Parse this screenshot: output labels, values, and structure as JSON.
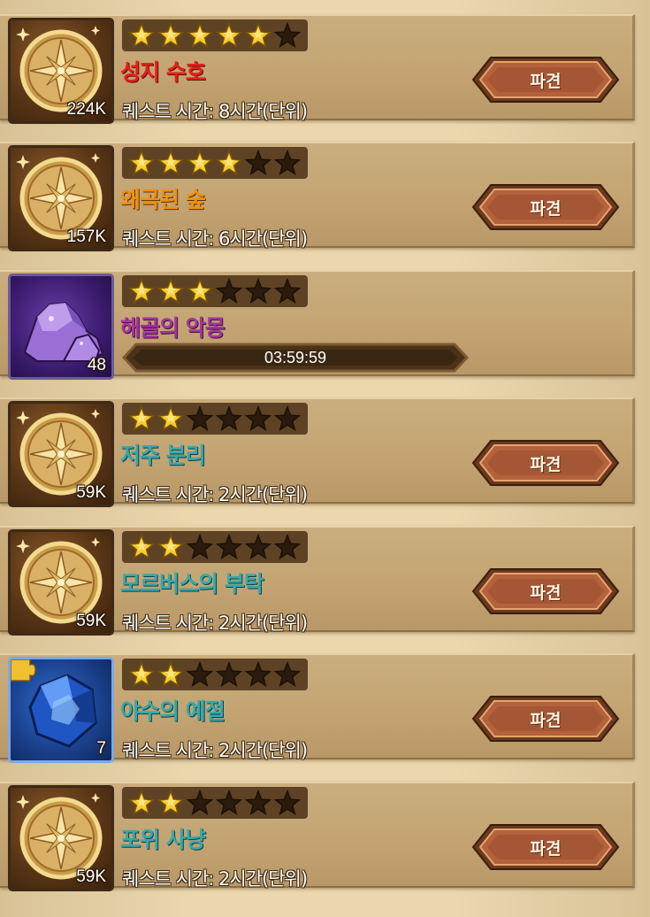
{
  "colors": {
    "star_on": "#f6cd2c",
    "star_off": "#2b1b0c",
    "name_red": "#e8201a",
    "name_orange": "#f09010",
    "name_violet": "#a4359c",
    "name_teal": "#38a8aa"
  },
  "quests": [
    {
      "icon": "compass-icon",
      "count": "224K",
      "stars": 5,
      "name": "성지 수호",
      "name_color": "red",
      "time": "퀘스트 시간: 8시간(단위)",
      "button": "파견"
    },
    {
      "icon": "compass-icon",
      "count": "157K",
      "stars": 4,
      "name": "왜곡된 숲",
      "name_color": "orange",
      "time": "퀘스트 시간: 6시간(단위)",
      "button": "파견"
    },
    {
      "icon": "purple-ore-icon",
      "count": "48",
      "stars": 3,
      "name": "해골의 악몽",
      "name_color": "violet",
      "timer": "03:59:59"
    },
    {
      "icon": "compass-icon",
      "count": "59K",
      "stars": 2,
      "name": "저주 분리",
      "name_color": "teal",
      "time": "퀘스트 시간: 2시간(단위)",
      "button": "파견"
    },
    {
      "icon": "compass-icon",
      "count": "59K",
      "stars": 2,
      "name": "모르버스의 부탁",
      "name_color": "teal",
      "time": "퀘스트 시간: 2시간(단위)",
      "button": "파견"
    },
    {
      "icon": "blue-crystal-piece-icon",
      "count": "7",
      "stars": 2,
      "name": "야수의 예절",
      "name_color": "teal",
      "time": "퀘스트 시간: 2시간(단위)",
      "button": "파견"
    },
    {
      "icon": "compass-icon",
      "count": "59K",
      "stars": 2,
      "name": "포위 사냥",
      "name_color": "teal",
      "time": "퀘스트 시간: 2시간(단위)",
      "button": "파견"
    }
  ]
}
